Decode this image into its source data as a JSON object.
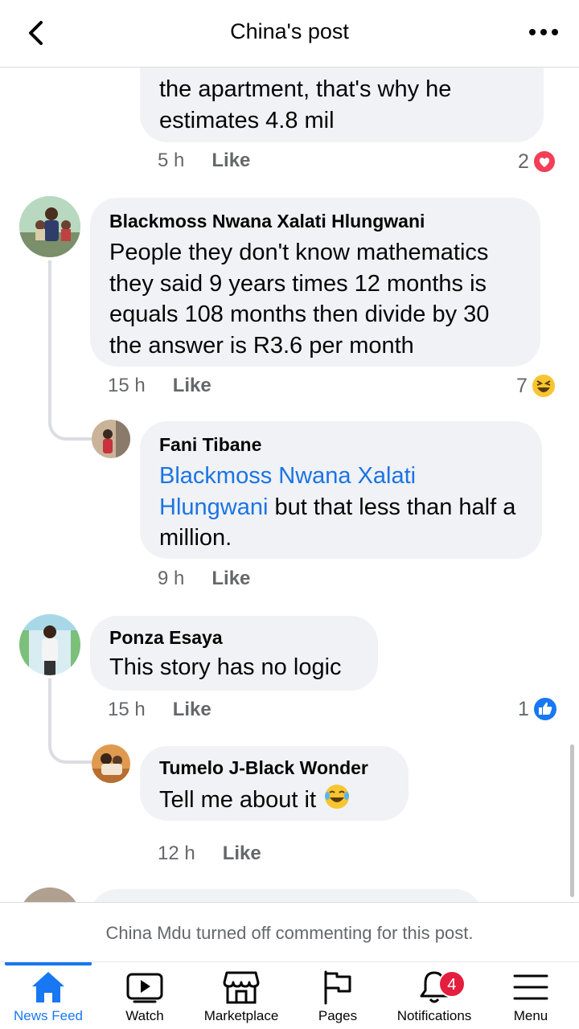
{
  "header": {
    "title": "China's post"
  },
  "comments": [
    {
      "text": "the apartment, that's why he estimates 4.8 mil",
      "time": "5 h",
      "like": "Like",
      "reaction_count": "2",
      "reaction": "love-reaction-icon"
    },
    {
      "author": "Blackmoss Nwana Xalati Hlungwani",
      "text": "People they don't know mathematics they said 9 years times 12 months is equals 108 months then divide by 30 the answer is R3.6 per month",
      "time": "15 h",
      "like": "Like",
      "reaction_count": "7",
      "reaction": "haha-reaction-icon"
    },
    {
      "author": "Fani Tibane",
      "mention": "Blackmoss Nwana Xalati Hlungwani",
      "text": " but that less than half a million.",
      "time": "9 h",
      "like": "Like"
    },
    {
      "author": "Ponza Esaya",
      "text": "This story has no logic",
      "time": "15 h",
      "like": "Like",
      "reaction_count": "1",
      "reaction": "like-reaction-icon"
    },
    {
      "author": "Tumelo J-Black Wonder",
      "text": "Tell me about it",
      "time": "12 h",
      "like": "Like"
    }
  ],
  "notice": {
    "name": "China Mdu",
    "text": " turned off commenting for this post."
  },
  "nav": [
    {
      "label": "News Feed",
      "icon": "home-icon",
      "active": true
    },
    {
      "label": "Watch",
      "icon": "watch-icon"
    },
    {
      "label": "Marketplace",
      "icon": "marketplace-icon"
    },
    {
      "label": "Pages",
      "icon": "flag-icon"
    },
    {
      "label": "Notifications",
      "icon": "bell-icon",
      "badge": "4"
    },
    {
      "label": "Menu",
      "icon": "menu-icon"
    }
  ],
  "colors": {
    "accent": "#1877f2",
    "bubble": "#f0f2f5",
    "badge": "#e41e3f",
    "mention": "#1b74e4"
  }
}
